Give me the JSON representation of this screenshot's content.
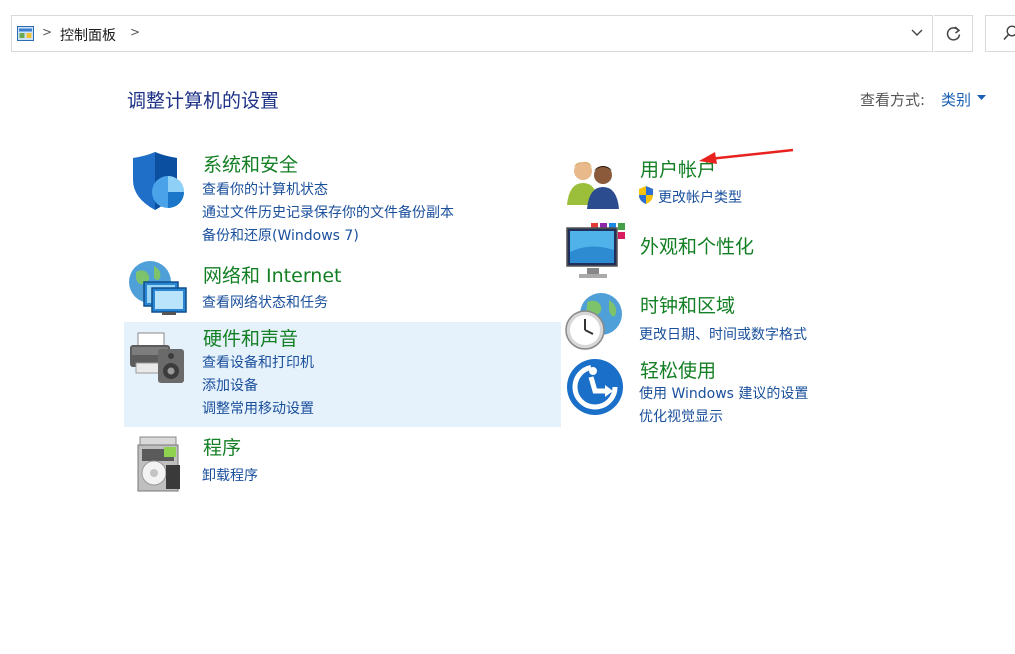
{
  "address": {
    "breadcrumb": "控制面板",
    "separator": ">"
  },
  "header": {
    "title": "调整计算机的设置",
    "view_by_label": "查看方式:",
    "view_by_value": "类别"
  },
  "categories": {
    "system_security": {
      "title": "系统和安全",
      "links": [
        "查看你的计算机状态",
        "通过文件历史记录保存你的文件备份副本",
        "备份和还原(Windows 7)"
      ]
    },
    "network": {
      "title": "网络和 Internet",
      "links": [
        "查看网络状态和任务"
      ]
    },
    "hardware": {
      "title": "硬件和声音",
      "links": [
        "查看设备和打印机",
        "添加设备",
        "调整常用移动设置"
      ]
    },
    "programs": {
      "title": "程序",
      "links": [
        "卸载程序"
      ]
    },
    "user_accounts": {
      "title": "用户帐户",
      "links": [
        "更改帐户类型"
      ]
    },
    "appearance": {
      "title": "外观和个性化",
      "links": []
    },
    "clock_region": {
      "title": "时钟和区域",
      "links": [
        "更改日期、时间或数字格式"
      ]
    },
    "ease_access": {
      "title": "轻松使用",
      "links": [
        "使用 Windows 建议的设置",
        "优化视觉显示"
      ]
    }
  },
  "colors": {
    "category_title": "#137f24",
    "link": "#1a4f9c",
    "page_title": "#1e3287",
    "hover": "#e5f1fb",
    "annotation": "#e8231f"
  }
}
